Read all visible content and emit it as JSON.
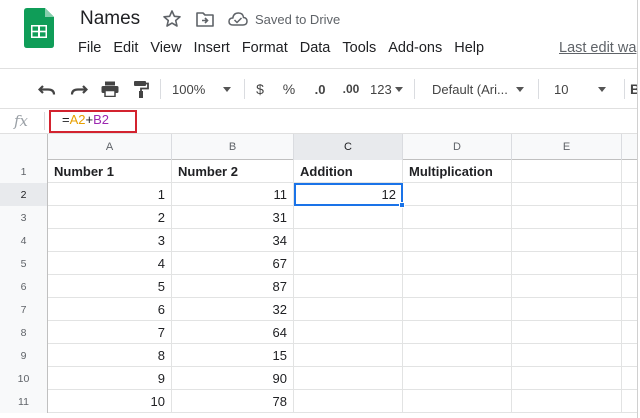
{
  "header": {
    "title": "Names",
    "saved_status": "Saved to Drive",
    "menu": [
      "File",
      "Edit",
      "View",
      "Insert",
      "Format",
      "Data",
      "Tools",
      "Add-ons",
      "Help"
    ],
    "last_edit": "Last edit wa"
  },
  "toolbar": {
    "zoom": "100%",
    "currency": "$",
    "percent": "%",
    "decrease_decimal": ".0",
    "increase_decimal": ".00",
    "more_formats": "123",
    "font": "Default (Ari...",
    "font_size": "10"
  },
  "formula_bar": {
    "fx": "fx",
    "formula_parts": [
      "=",
      "A2",
      "+",
      "B2"
    ]
  },
  "grid": {
    "columns": [
      "A",
      "B",
      "C",
      "D",
      "E"
    ],
    "active_column": "C",
    "active_row": 2,
    "rows": [
      {
        "n": "1",
        "cells": [
          "Number 1",
          "Number 2",
          "Addition",
          "Multiplication",
          ""
        ]
      },
      {
        "n": "2",
        "cells": [
          "1",
          "11",
          "12",
          "",
          ""
        ]
      },
      {
        "n": "3",
        "cells": [
          "2",
          "31",
          "",
          "",
          ""
        ]
      },
      {
        "n": "4",
        "cells": [
          "3",
          "34",
          "",
          "",
          ""
        ]
      },
      {
        "n": "5",
        "cells": [
          "4",
          "67",
          "",
          "",
          ""
        ]
      },
      {
        "n": "6",
        "cells": [
          "5",
          "87",
          "",
          "",
          ""
        ]
      },
      {
        "n": "7",
        "cells": [
          "6",
          "32",
          "",
          "",
          ""
        ]
      },
      {
        "n": "8",
        "cells": [
          "7",
          "64",
          "",
          "",
          ""
        ]
      },
      {
        "n": "9",
        "cells": [
          "8",
          "15",
          "",
          "",
          ""
        ]
      },
      {
        "n": "10",
        "cells": [
          "9",
          "90",
          "",
          "",
          ""
        ]
      },
      {
        "n": "11",
        "cells": [
          "10",
          "78",
          "",
          "",
          ""
        ]
      }
    ]
  },
  "colors": {
    "logo_green": "#0f9d58",
    "selection_blue": "#1a73e8",
    "highlight_red": "#d3232f",
    "ref_orange": "#e8a000",
    "ref_purple": "#9c27b0"
  },
  "icons": [
    "sheets-logo-icon",
    "star-icon",
    "move-to-folder-icon",
    "cloud-saved-icon",
    "undo-icon",
    "redo-icon",
    "print-icon",
    "paint-format-icon",
    "chevron-down-icon",
    "fx-icon"
  ]
}
